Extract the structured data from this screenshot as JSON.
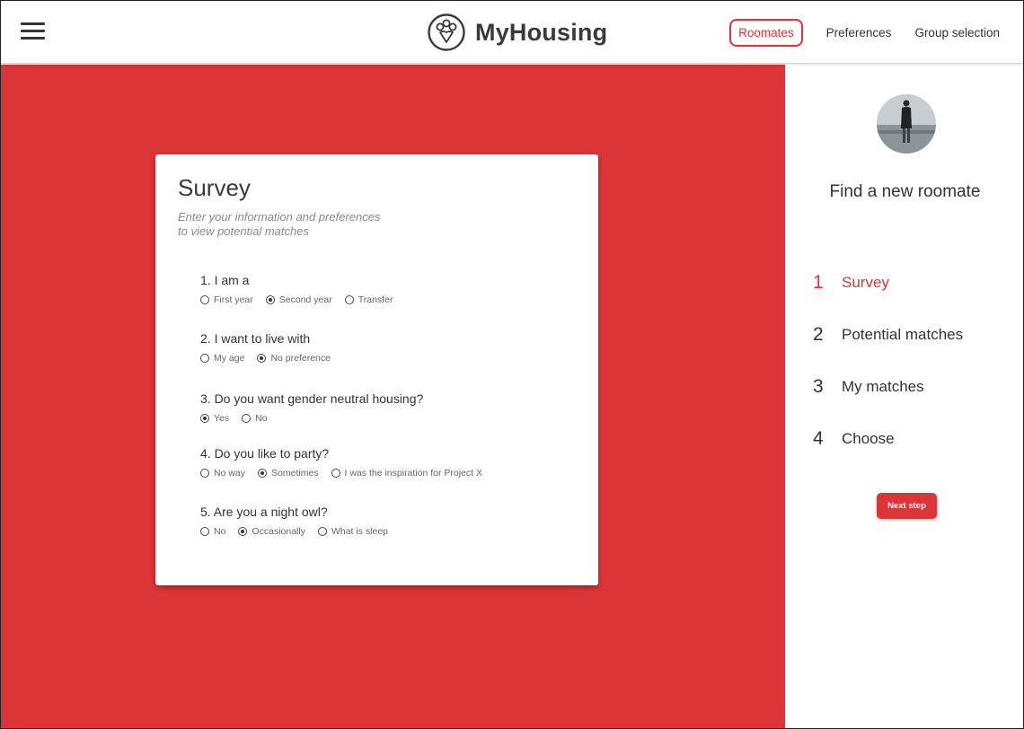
{
  "header": {
    "brand_name": "MyHousing",
    "nav": [
      {
        "label": "Roomates",
        "active": true
      },
      {
        "label": "Preferences",
        "active": false
      },
      {
        "label": "Group selection",
        "active": false
      }
    ]
  },
  "colors": {
    "accent": "#dc3537",
    "text": "#333333",
    "muted": "#8a8a8a"
  },
  "survey": {
    "title": "Survey",
    "subtitle_line1": "Enter your information and preferences",
    "subtitle_line2": "to view potential matches",
    "questions": [
      {
        "label": "1. I am a",
        "options": [
          {
            "label": "First year",
            "selected": false
          },
          {
            "label": "Second year",
            "selected": true
          },
          {
            "label": "Transfer",
            "selected": false
          }
        ]
      },
      {
        "label": "2. I want to live with",
        "options": [
          {
            "label": "My age",
            "selected": false
          },
          {
            "label": "No preference",
            "selected": true
          }
        ]
      },
      {
        "label": "3. Do you want gender neutral housing?",
        "options": [
          {
            "label": "Yes",
            "selected": true
          },
          {
            "label": "No",
            "selected": false
          }
        ]
      },
      {
        "label": "4. Do you like to party?",
        "options": [
          {
            "label": "No way",
            "selected": false
          },
          {
            "label": "Sometimes",
            "selected": true
          },
          {
            "label": "I was the inspiration for Project X",
            "selected": false
          }
        ]
      },
      {
        "label": "5. Are you a night owl?",
        "options": [
          {
            "label": "No",
            "selected": false
          },
          {
            "label": "Occasionally",
            "selected": true
          },
          {
            "label": "What is sleep",
            "selected": false
          }
        ]
      }
    ]
  },
  "panel": {
    "title": "Find a new roomate",
    "steps": [
      {
        "number": "1",
        "label": "Survey",
        "active": true
      },
      {
        "number": "2",
        "label": "Potential matches",
        "active": false
      },
      {
        "number": "3",
        "label": "My matches",
        "active": false
      },
      {
        "number": "4",
        "label": "Choose",
        "active": false
      }
    ],
    "next_button": "Next step"
  }
}
